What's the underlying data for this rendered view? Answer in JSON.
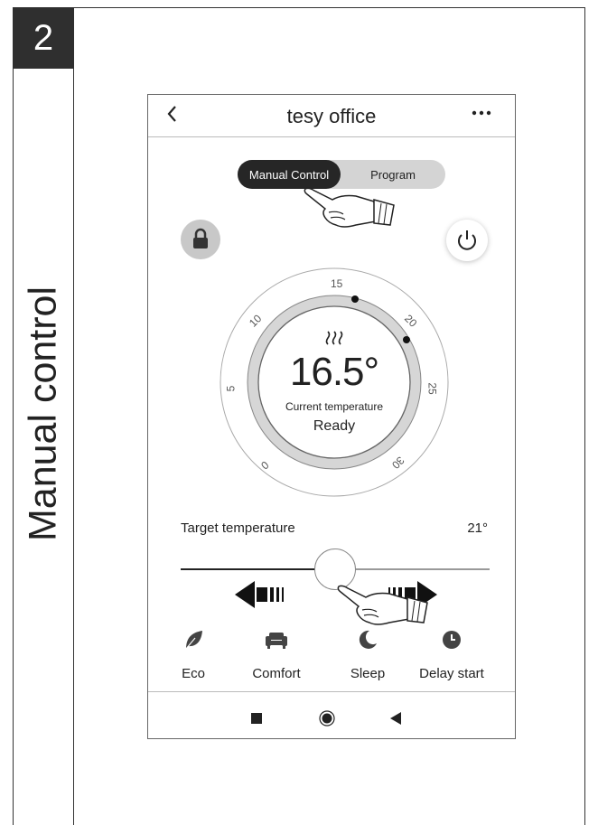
{
  "step": {
    "number": "2"
  },
  "section": {
    "title": "Manual control"
  },
  "app": {
    "back_icon": "chevron-left-icon",
    "title": "tesy office",
    "menu_icon": "more-icon"
  },
  "tabs": {
    "active": "Manual Control",
    "inactive": "Program"
  },
  "controls": {
    "lock_icon": "lock-icon",
    "power_icon": "power-icon"
  },
  "dial": {
    "scale": [
      "0",
      "5",
      "10",
      "15",
      "20",
      "25",
      "30"
    ],
    "heating_icon": "heat-waves-icon",
    "value": "16.5°",
    "caption": "Current temperature",
    "status": "Ready"
  },
  "target": {
    "label": "Target temperature",
    "value": "21°"
  },
  "modes": [
    {
      "label": "Eco",
      "icon": "leaf-icon"
    },
    {
      "label": "Comfort",
      "icon": "armchair-icon"
    },
    {
      "label": "Sleep",
      "icon": "moon-icon"
    },
    {
      "label": "Delay start",
      "icon": "clock-icon"
    }
  ],
  "navigation": [
    "square-icon",
    "circle-icon",
    "triangle-back-icon"
  ],
  "colors": {
    "dark": "#262626",
    "light_gray": "#d4d4d4",
    "track": "#999999"
  }
}
